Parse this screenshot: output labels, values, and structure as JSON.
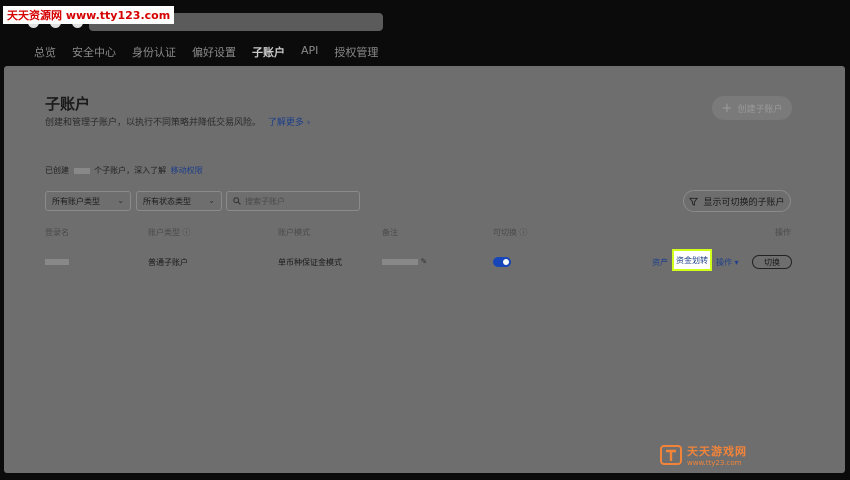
{
  "watermark": {
    "text": "天天资源网 www.tty123.com"
  },
  "nav": {
    "items": [
      {
        "label": "总览",
        "active": false
      },
      {
        "label": "安全中心",
        "active": false
      },
      {
        "label": "身份认证",
        "active": false
      },
      {
        "label": "偏好设置",
        "active": false
      },
      {
        "label": "子账户",
        "active": true
      },
      {
        "label": "API",
        "active": false
      },
      {
        "label": "授权管理",
        "active": false
      }
    ]
  },
  "header": {
    "title": "子账户",
    "description": "创建和管理子账户，以执行不同策略并降低交易风险。",
    "learn_more": "了解更多 ›",
    "create_button": "创建子账户"
  },
  "stats": {
    "prefix": "已创建",
    "suffix": "个子账户，深入了解",
    "link": "移动权限"
  },
  "filters": {
    "account_type": "所有账户类型",
    "status_type": "所有状态类型",
    "search_placeholder": "搜索子账户",
    "show_switchable": "显示可切换的子账户"
  },
  "table": {
    "headers": {
      "login_name": "登录名",
      "account_type": "账户类型 ⓘ",
      "account_mode": "账户模式",
      "remark": "备注",
      "switchable": "可切换 ⓘ",
      "actions": "操作"
    },
    "rows": [
      {
        "account_type": "普通子账户",
        "account_mode": "单币种保证金模式",
        "switchable": true,
        "actions": {
          "assets": "资产",
          "transfer": "资金划转",
          "operations": "操作 ▾",
          "switch": "切换"
        }
      }
    ]
  },
  "brand_logo": {
    "name": "天天游戏网",
    "url": "www.tty23.com"
  },
  "colors": {
    "page_bg": "#6e6e6e",
    "link": "#1d3e8a",
    "toggle_on": "#1746b8",
    "highlight_border": "#cfff1a",
    "logo_orange": "#f2843a"
  }
}
